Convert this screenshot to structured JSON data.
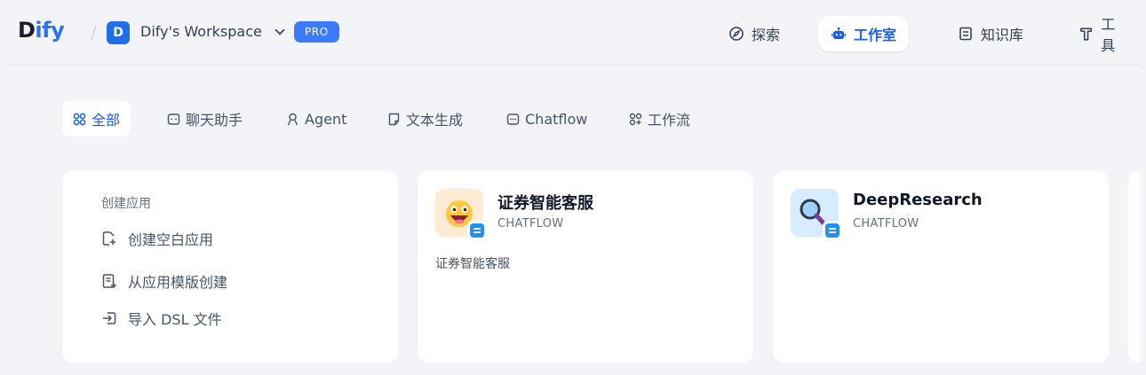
{
  "header": {
    "logo": {
      "part1": "D",
      "part2": "ify"
    },
    "workspace": {
      "avatar_letter": "D",
      "name": "Dify's Workspace",
      "badge": "PRO"
    },
    "nav": [
      {
        "label": "探索",
        "icon": "explore-icon",
        "active": false
      },
      {
        "label": "工作室",
        "icon": "robot-icon",
        "active": true
      },
      {
        "label": "知识库",
        "icon": "book-icon",
        "active": false
      },
      {
        "label": "工具",
        "icon": "tool-icon",
        "active": false
      }
    ]
  },
  "filters": [
    {
      "label": "全部",
      "icon": "grid-icon",
      "active": true
    },
    {
      "label": "聊天助手",
      "icon": "chat-icon",
      "active": false
    },
    {
      "label": "Agent",
      "icon": "agent-icon",
      "active": false
    },
    {
      "label": "文本生成",
      "icon": "document-icon",
      "active": false
    },
    {
      "label": "Chatflow",
      "icon": "chatflow-icon",
      "active": false
    },
    {
      "label": "工作流",
      "icon": "workflow-icon",
      "active": false
    }
  ],
  "create_card": {
    "title": "创建应用",
    "items": [
      {
        "label": "创建空白应用",
        "icon": "new-file-icon"
      },
      {
        "label": "从应用模版创建",
        "icon": "template-icon"
      },
      {
        "label": "导入 DSL 文件",
        "icon": "import-icon"
      }
    ]
  },
  "apps": [
    {
      "name": "证券智能客服",
      "type": "CHATFLOW",
      "description": "证券智能客服",
      "icon": "grinning-face-icon",
      "icon_bg": "#fdebd3"
    },
    {
      "name": "DeepResearch",
      "type": "CHATFLOW",
      "description": "",
      "icon": "magnifier-icon",
      "icon_bg": "#d6ecff"
    }
  ],
  "colors": {
    "accent": "#155eef",
    "background": "#f2f4f7",
    "card": "#ffffff"
  }
}
